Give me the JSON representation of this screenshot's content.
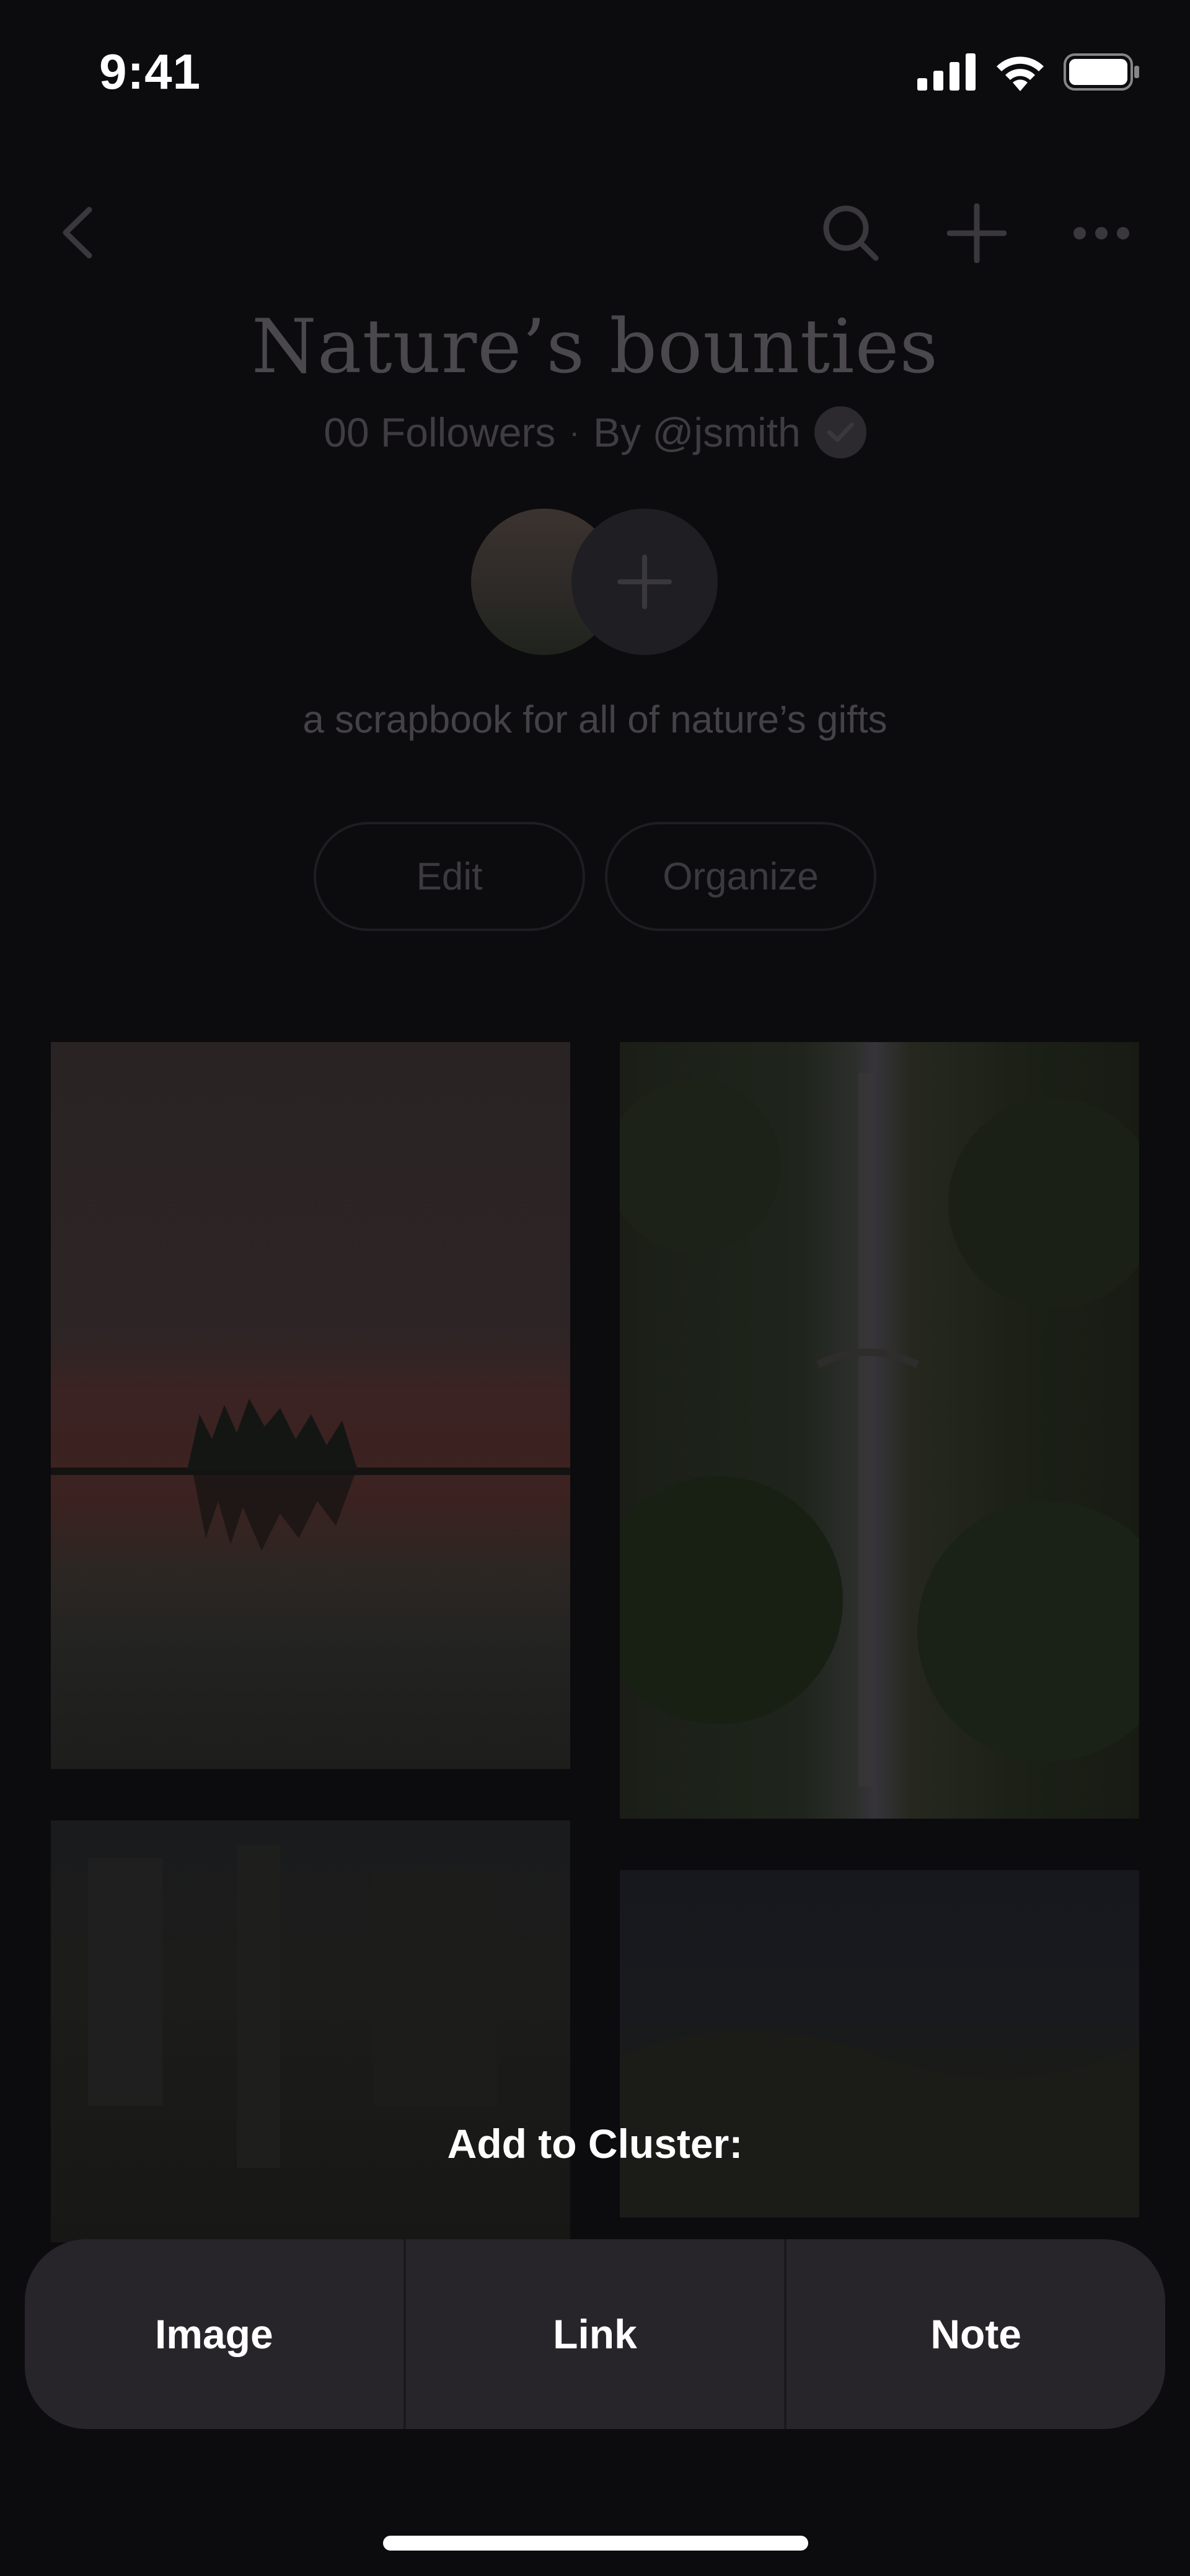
{
  "status_bar": {
    "time": "9:41",
    "icons": [
      "signal-icon",
      "wifi-icon",
      "battery-icon"
    ]
  },
  "nav": {
    "icons": [
      "back-icon",
      "search-icon",
      "add-icon",
      "more-icon"
    ]
  },
  "collection": {
    "title": "Nature’s bounties",
    "followers": "00 Followers",
    "separator": "·",
    "author": "By @jsmith",
    "description": "a scrapbook for all of nature’s gifts",
    "edit_label": "Edit",
    "organize_label": "Organize"
  },
  "grid": {
    "items": [
      "sunset-lake-image",
      "waterfall-image",
      "interior-image",
      "landscape-image"
    ]
  },
  "sheet": {
    "title": "Add to Cluster:",
    "actions": [
      "Image",
      "Link",
      "Note"
    ]
  },
  "colors": {
    "background": "#0c0b0e",
    "sheet_bar": "#27252a",
    "text": "#ffffff"
  }
}
